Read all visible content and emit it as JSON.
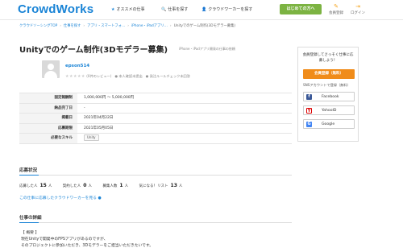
{
  "header": {
    "logo": "CrowdWorks",
    "nav": [
      {
        "icon": "★",
        "label": "オススメの仕事"
      },
      {
        "icon": "🔍",
        "label": "仕事を探す"
      },
      {
        "icon": "👤",
        "label": "クラウドワーカーを探す"
      }
    ],
    "start_button": "はじめての方へ",
    "member_register": "会員登録",
    "login": "ログイン"
  },
  "breadcrumb": [
    "クラウドソーシングTOP",
    "仕事を探す",
    "アプリ・スマートフォ…",
    "iPhone・iPadアプリ…",
    "Unityでのゲーム制作(3Dモデラー募集)"
  ],
  "job": {
    "title": "Unityでのゲーム制作(3Dモデラー募集)",
    "category_note": "iPhone・iPadアプリ開発の仕事の依頼"
  },
  "client": {
    "name": "epson514",
    "stars": "★★★★★",
    "reviews": "(0件のレビュー)",
    "identity": "本人確認未提出",
    "rule_check": "発注ルールチェック未回答"
  },
  "info": [
    {
      "label": "固定報酬制",
      "value": "1,000,000円 〜 5,000,000円"
    },
    {
      "label": "納品完了日",
      "value": "-"
    },
    {
      "label": "掲載日",
      "value": "2021年04月22日"
    },
    {
      "label": "応募期限",
      "value": "2021年05月05日"
    },
    {
      "label": "必要なスキル",
      "value": "Unity"
    }
  ],
  "apply": {
    "section_title": "応募状況",
    "stats": [
      {
        "label": "応募した人",
        "value": "15",
        "unit": "人"
      },
      {
        "label": "契約した人",
        "value": "0",
        "unit": "人"
      },
      {
        "label": "募集人数",
        "value": "1",
        "unit": "人"
      },
      {
        "label": "気になる！リスト",
        "value": "13",
        "unit": "人"
      }
    ],
    "see_workers_link": "この仕事に応募したクラウドワーカーを見る ●"
  },
  "detail": {
    "section_title": "仕事の詳細",
    "lines": [
      "【 概要 】",
      "現在Unityで開発中のFPSアプリがあるのですが、",
      "そのプロジェクトに参加いただき、3Dモデラーをご担当いただきたいです。"
    ]
  },
  "sidebar": {
    "message_line1": "会員登録してさっそく仕事に応",
    "message_line2": "募しよう！",
    "register_button": "会員登録（無料）",
    "sns_label": "SNSアカウントで登録（無料）",
    "facebook": "Facebook",
    "yahoo": "YahooID",
    "google": "Google"
  },
  "colors": {
    "brand": "#1a84d6",
    "start_green": "#7cb342",
    "register_orange": "#f08c1a"
  }
}
